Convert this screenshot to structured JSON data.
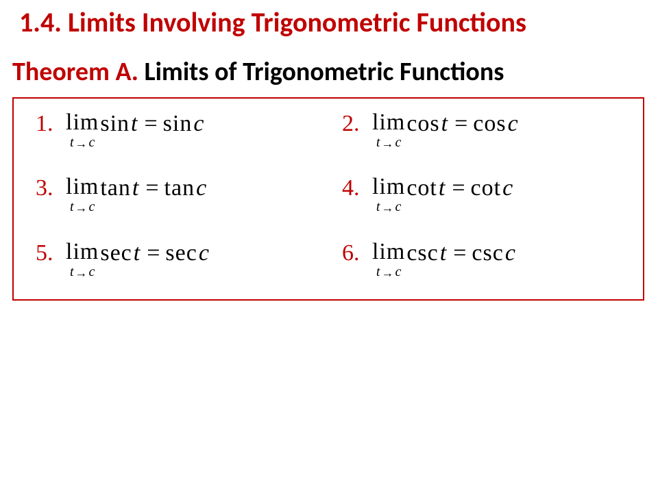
{
  "title": "1.4. Limits Involving Trigonometric Functions",
  "theorem": {
    "label": "Theorem A.",
    "name": "Limits of Trigonometric Functions"
  },
  "limitWord": "lim",
  "subscript": {
    "lhs": "t",
    "arrow": "→",
    "rhs": "c"
  },
  "eq": "=",
  "items": [
    {
      "num": "1.",
      "fn": "sin",
      "arg": "t",
      "fnR": "sin",
      "argR": "c"
    },
    {
      "num": "2.",
      "fn": "cos",
      "arg": "t",
      "fnR": "cos",
      "argR": "c"
    },
    {
      "num": "3.",
      "fn": "tan",
      "arg": "t",
      "fnR": "tan",
      "argR": "c"
    },
    {
      "num": "4.",
      "fn": "cot",
      "arg": "t",
      "fnR": "cot",
      "argR": "c"
    },
    {
      "num": "5.",
      "fn": "sec",
      "arg": "t",
      "fnR": "sec",
      "argR": "c"
    },
    {
      "num": "6.",
      "fn": "csc",
      "arg": "t",
      "fnR": "csc",
      "argR": "c"
    }
  ]
}
